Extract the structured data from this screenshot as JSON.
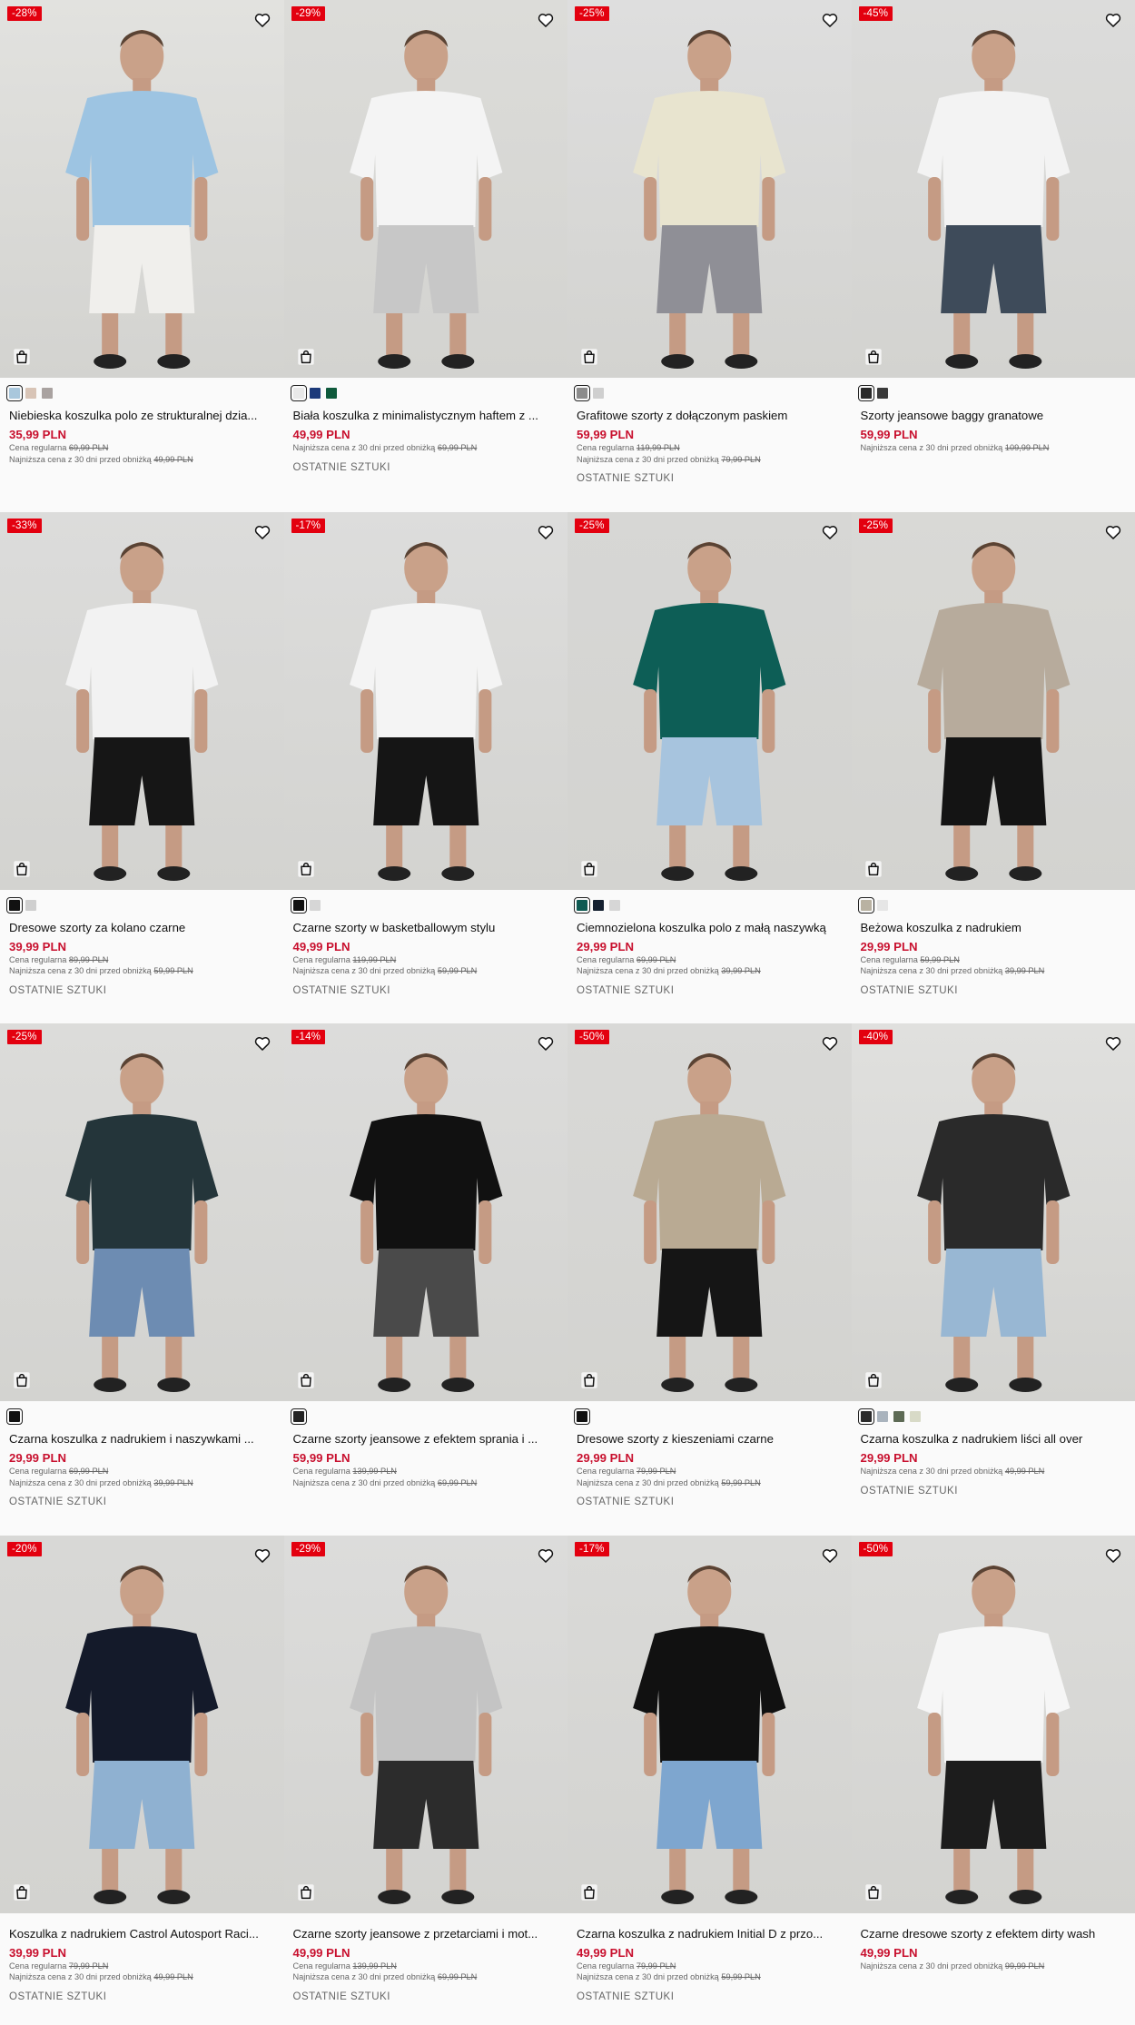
{
  "labels": {
    "regular": "Cena regularna",
    "lowest": "Najniższa cena z 30 dni przed obniżką",
    "last_items": "OSTATNIE SZTUKI"
  },
  "products": [
    {
      "badge": "-28%",
      "name": "Niebieska koszulka polo ze strukturalnej dzia...",
      "price": "35,99 PLN",
      "regular": "69,99 PLN",
      "lowest": "49,99 PLN",
      "last": false,
      "swatches": [
        "#a9c7dc",
        "#d8c4b6",
        "#a9a2a0"
      ],
      "shirt": "#9dc4e2",
      "bottom": "#f0efec",
      "bg": "#e2e2df"
    },
    {
      "badge": "-29%",
      "name": "Biała koszulka z minimalistycznym haftem z ...",
      "price": "49,99 PLN",
      "regular": "",
      "lowest": "69,99 PLN",
      "last": true,
      "swatches": [
        "#e8e8e8",
        "#1d3a7a",
        "#0f5a3c"
      ],
      "shirt": "#f4f4f4",
      "bottom": "#c7c7c7",
      "bg": "#dcdcd9"
    },
    {
      "badge": "-25%",
      "name": "Grafitowe szorty z dołączonym paskiem",
      "price": "59,99 PLN",
      "regular": "119,99 PLN",
      "lowest": "79,99 PLN",
      "last": true,
      "swatches": [
        "#8c8c8c",
        "#cfcfcf"
      ],
      "shirt": "#e8e4cf",
      "bottom": "#8f8f96",
      "bg": "#dedede"
    },
    {
      "badge": "-45%",
      "name": "Szorty jeansowe baggy granatowe",
      "price": "59,99 PLN",
      "regular": "",
      "lowest": "109,99 PLN",
      "last": false,
      "swatches": [
        "#2a2a2a",
        "#3a3a3a"
      ],
      "shirt": "#f3f3f3",
      "bottom": "#3e4b5a",
      "bg": "#dcdcdb"
    },
    {
      "badge": "-33%",
      "name": "Dresowe szorty za kolano czarne",
      "price": "39,99 PLN",
      "regular": "89,99 PLN",
      "lowest": "59,99 PLN",
      "last": true,
      "swatches": [
        "#111111",
        "#cfcfcf"
      ],
      "shirt": "#f2f2f2",
      "bottom": "#161616",
      "bg": "#dcdcdb"
    },
    {
      "badge": "-17%",
      "name": "Czarne szorty w basketballowym stylu",
      "price": "49,99 PLN",
      "regular": "119,99 PLN",
      "lowest": "59,99 PLN",
      "last": true,
      "swatches": [
        "#111111",
        "#d6d6d6"
      ],
      "shirt": "#f4f4f4",
      "bottom": "#151515",
      "bg": "#dddddc"
    },
    {
      "badge": "-25%",
      "name": "Ciemnozielona koszulka polo z małą naszywką",
      "price": "29,99 PLN",
      "regular": "69,99 PLN",
      "lowest": "39,99 PLN",
      "last": true,
      "swatches": [
        "#0f5a52",
        "#142030",
        "#d6d6d6"
      ],
      "shirt": "#0d5e56",
      "bottom": "#a7c4de",
      "bg": "#d7d7d5"
    },
    {
      "badge": "-25%",
      "name": "Beżowa koszulka z nadrukiem",
      "price": "29,99 PLN",
      "regular": "59,99 PLN",
      "lowest": "39,99 PLN",
      "last": true,
      "swatches": [
        "#b9b2a2",
        "#e6e6e6"
      ],
      "shirt": "#b7ab9c",
      "bottom": "#141414",
      "bg": "#d9d9d6"
    },
    {
      "badge": "-25%",
      "name": "Czarna koszulka z nadrukiem i naszywkami ...",
      "price": "29,99 PLN",
      "regular": "69,99 PLN",
      "lowest": "39,99 PLN",
      "last": true,
      "swatches": [
        "#111111"
      ],
      "shirt": "#24353a",
      "bottom": "#6d8cb2",
      "bg": "#dcdcda"
    },
    {
      "badge": "-14%",
      "name": "Czarne szorty jeansowe z efektem sprania i ...",
      "price": "59,99 PLN",
      "regular": "139,99 PLN",
      "lowest": "69,99 PLN",
      "last": false,
      "swatches": [
        "#222222"
      ],
      "shirt": "#111111",
      "bottom": "#4a4a4a",
      "bg": "#dcdcdb"
    },
    {
      "badge": "-50%",
      "name": "Dresowe szorty z kieszeniami czarne",
      "price": "29,99 PLN",
      "regular": "79,99 PLN",
      "lowest": "59,99 PLN",
      "last": true,
      "swatches": [
        "#111111"
      ],
      "shirt": "#b9aa93",
      "bottom": "#151515",
      "bg": "#d9d9d7"
    },
    {
      "badge": "-40%",
      "name": "Czarna koszulka z nadrukiem liści all over",
      "price": "29,99 PLN",
      "regular": "",
      "lowest": "49,99 PLN",
      "last": true,
      "swatches": [
        "#2b2b2b",
        "#a9b3bd",
        "#5d6a55",
        "#d8dac7"
      ],
      "shirt": "#2a2a2a",
      "bottom": "#98b7d3",
      "bg": "#e0e0de"
    },
    {
      "badge": "-20%",
      "name": "Koszulka z nadrukiem Castrol Autosport Raci...",
      "price": "39,99 PLN",
      "regular": "79,99 PLN",
      "lowest": "49,99 PLN",
      "last": true,
      "swatches": [],
      "shirt": "#141a2a",
      "bottom": "#8fb1d1",
      "bg": "#d8d8d6"
    },
    {
      "badge": "-29%",
      "name": "Czarne szorty jeansowe z przetarciami i mot...",
      "price": "49,99 PLN",
      "regular": "139,99 PLN",
      "lowest": "69,99 PLN",
      "last": true,
      "swatches": [],
      "shirt": "#c4c4c4",
      "bottom": "#2c2c2c",
      "bg": "#dcdcdb"
    },
    {
      "badge": "-17%",
      "name": "Czarna koszulka z nadrukiem Initial D z przo...",
      "price": "49,99 PLN",
      "regular": "79,99 PLN",
      "lowest": "59,99 PLN",
      "last": true,
      "swatches": [],
      "shirt": "#111111",
      "bottom": "#7ea6cf",
      "bg": "#dadad8"
    },
    {
      "badge": "-50%",
      "name": "Czarne dresowe szorty z efektem dirty wash",
      "price": "49,99 PLN",
      "regular": "",
      "lowest": "99,99 PLN",
      "last": false,
      "swatches": [],
      "shirt": "#f6f6f6",
      "bottom": "#1c1c1c",
      "bg": "#dcdcda"
    }
  ]
}
